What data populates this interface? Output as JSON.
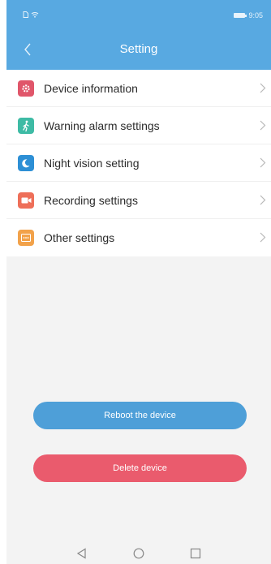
{
  "status": {
    "time": "9:05"
  },
  "header": {
    "title": "Setting"
  },
  "menu": [
    {
      "label": "Device information",
      "icon": "gear-icon",
      "color": "#e0566a"
    },
    {
      "label": "Warning alarm settings",
      "icon": "walking-person-icon",
      "color": "#3ebba5"
    },
    {
      "label": "Night vision setting",
      "icon": "moon-icon",
      "color": "#2d8fd5"
    },
    {
      "label": "Recording settings",
      "icon": "video-camera-icon",
      "color": "#ee6f59"
    },
    {
      "label": "Other settings",
      "icon": "more-box-icon",
      "color": "#f2a24a"
    }
  ],
  "buttons": {
    "reboot": "Reboot the device",
    "delete": "Delete device"
  },
  "colors": {
    "primary": "#58a9e1",
    "danger": "#ea5b6d"
  }
}
